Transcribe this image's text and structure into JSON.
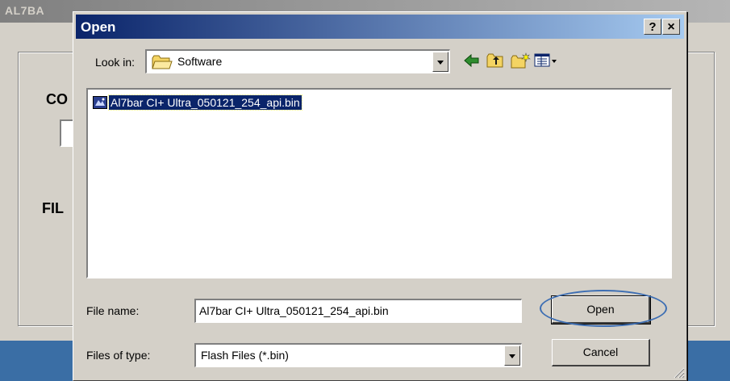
{
  "background_window": {
    "title": "AL7BA",
    "label_co": "CO",
    "label_fil": "FIL"
  },
  "dialog": {
    "title": "Open",
    "help_button": "?",
    "close_button": "×",
    "look_in_label": "Look in:",
    "look_in_value": "Software",
    "files": [
      {
        "name": "Al7bar CI+ Ultra_050121_254_api.bin",
        "selected": true
      }
    ],
    "file_name_label": "File name:",
    "file_name_value": "Al7bar CI+ Ultra_050121_254_api.bin",
    "files_of_type_label": "Files of type:",
    "files_of_type_value": "Flash Files (*.bin)",
    "open_button": "Open",
    "cancel_button": "Cancel"
  },
  "colors": {
    "title_bar_start": "#0a246a",
    "title_bar_end": "#a6caf0",
    "selection": "#0a246a",
    "dialog_face": "#d4d0c8",
    "highlight_ring": "#3d6eb3",
    "desktop": "#3a6ea5"
  },
  "icons": {
    "look_in": "folder-open-icon",
    "back": "back-arrow-icon",
    "up": "up-one-level-icon",
    "new_folder": "new-folder-icon",
    "view": "view-menu-icon",
    "file": "bin-file-icon"
  }
}
